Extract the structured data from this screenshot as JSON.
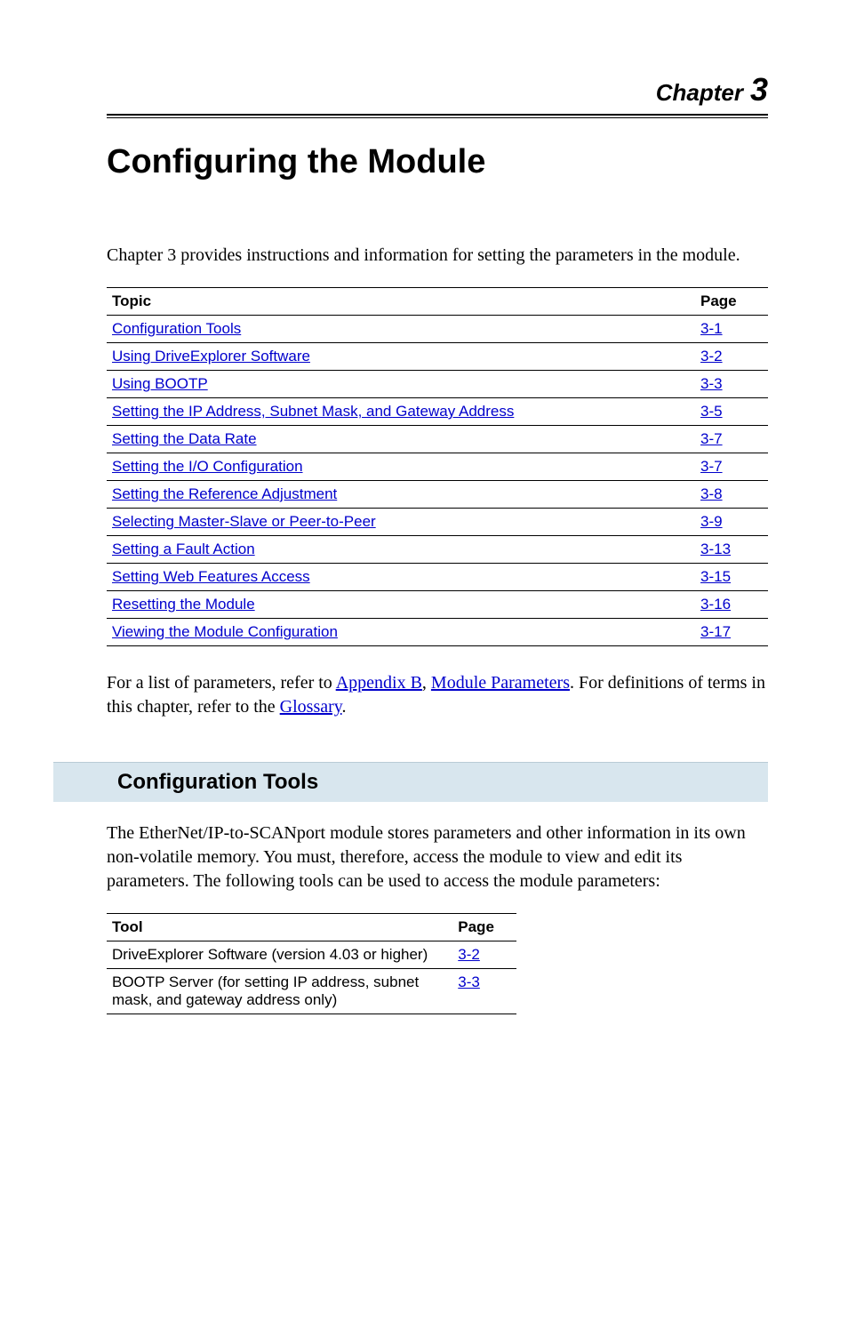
{
  "chapter": {
    "label": "Chapter",
    "number": "3"
  },
  "title": "Configuring the Module",
  "intro": "Chapter 3 provides instructions and information for setting the parameters in the module.",
  "toc": {
    "headers": {
      "topic": "Topic",
      "page": "Page"
    },
    "rows": [
      {
        "topic": "Configuration Tools",
        "page": "3-1"
      },
      {
        "topic": "Using DriveExplorer Software",
        "page": "3-2"
      },
      {
        "topic": "Using BOOTP",
        "page": "3-3"
      },
      {
        "topic": "Setting the IP Address, Subnet Mask, and Gateway Address",
        "page": "3-5"
      },
      {
        "topic": "Setting the Data Rate",
        "page": "3-7"
      },
      {
        "topic": "Setting the I/O Configuration",
        "page": "3-7"
      },
      {
        "topic": "Setting the Reference Adjustment",
        "page": "3-8"
      },
      {
        "topic": "Selecting Master-Slave or Peer-to-Peer",
        "page": "3-9"
      },
      {
        "topic": "Setting a Fault Action",
        "page": "3-13"
      },
      {
        "topic": "Setting Web Features Access",
        "page": "3-15"
      },
      {
        "topic": "Resetting the Module",
        "page": "3-16"
      },
      {
        "topic": "Viewing the Module Configuration",
        "page": "3-17"
      }
    ]
  },
  "post_toc": {
    "prefix": "For a list of parameters, refer to ",
    "link1": "Appendix B",
    "sep1": ", ",
    "link2": "Module Parameters",
    "mid": ". For definitions of terms in this chapter, refer to the ",
    "link3": "Glossary",
    "suffix": "."
  },
  "section": {
    "heading": "Configuration Tools",
    "para": "The EtherNet/IP-to-SCANport module stores parameters and other information in its own non-volatile memory. You must, therefore, access the module to view and edit its parameters. The following tools can be used to access the module parameters:",
    "table": {
      "headers": {
        "tool": "Tool",
        "page": "Page"
      },
      "rows": [
        {
          "tool": "DriveExplorer Software (version 4.03 or higher)",
          "page": "3-2"
        },
        {
          "tool": "BOOTP Server (for setting IP address, subnet mask, and gateway address only)",
          "page": "3-3"
        }
      ]
    }
  }
}
